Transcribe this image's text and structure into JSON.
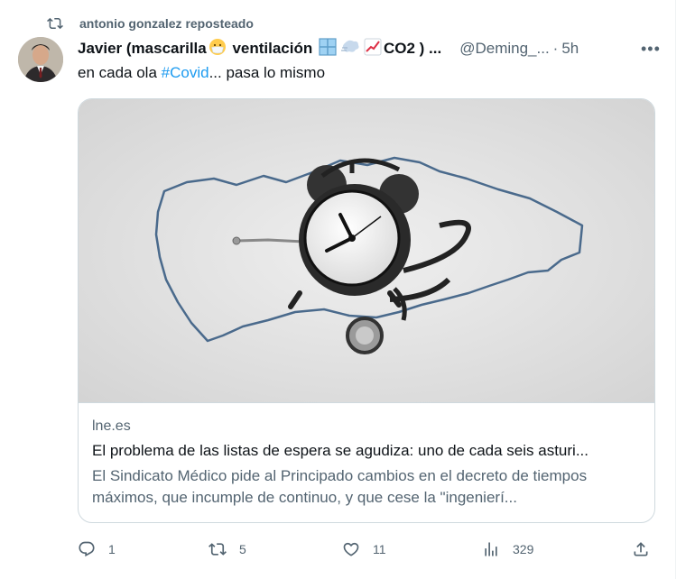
{
  "repost": {
    "label": "antonio gonzalez reposteado"
  },
  "tweet": {
    "author_name_prefix": "Javier (mascarilla",
    "author_name_mid1": " ventilación ",
    "author_name_suffix": "CO2 ) ...",
    "handle": "@Deming_...",
    "separator": "·",
    "time": "5h",
    "more": "•••",
    "text_before": "en cada ola ",
    "hashtag": "#Covid",
    "text_after": "... pasa lo mismo"
  },
  "card": {
    "domain": "lne.es",
    "title": "El problema de las listas de espera se agudiza: uno de cada seis asturi...",
    "description": "El Sindicato Médico pide al Principado cambios en el decreto de tiempos máximos, que incumple de continuo, y que cese la \"ingenierí..."
  },
  "actions": {
    "replies": "1",
    "reposts": "5",
    "likes": "11",
    "views": "329"
  },
  "colors": {
    "secondary_text": "#536471",
    "link": "#1d9bf0",
    "border": "#cfd9de"
  }
}
